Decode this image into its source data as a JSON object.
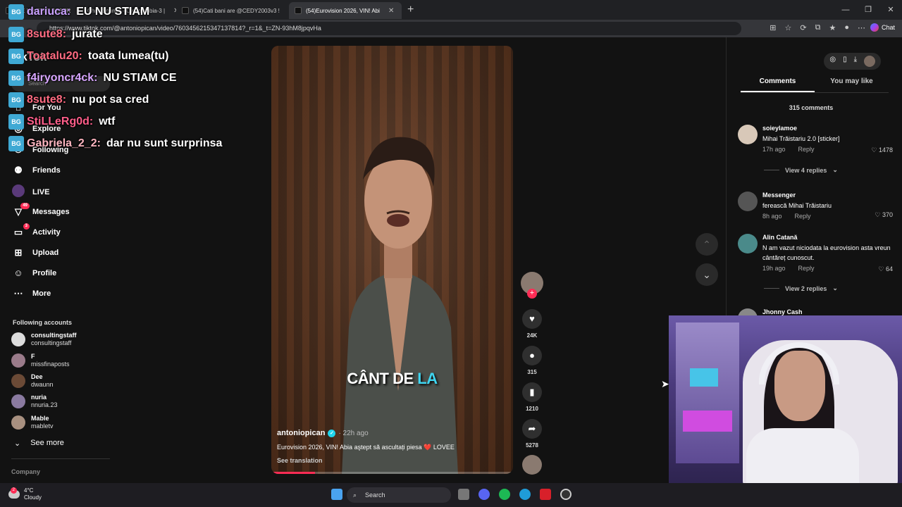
{
  "browser": {
    "tabs": [
      {
        "label": "CE NU STITI DESPRE BISOI - YouT",
        "active": false
      },
      {
        "label": "Chris Sounds - Oleaor fobia-3 |",
        "active": false
      },
      {
        "label": "(54)Cati bani are @CEDY2003v3 !",
        "active": false
      },
      {
        "label": "(54)Eurovision 2026, VIN! Abi",
        "active": true
      }
    ],
    "url": "https://www.tiktok.com/@antoniopican/video/7603456215347137814?_r=1&_t=ZN-93hM8jpqvHa",
    "chat_label": "Chat"
  },
  "sidebar": {
    "logo": "TikTok",
    "search_placeholder": "Search",
    "nav": [
      {
        "label": "For You",
        "icon": "home-icon"
      },
      {
        "label": "Explore",
        "icon": "compass-icon"
      },
      {
        "label": "Following",
        "icon": "following-icon"
      },
      {
        "label": "Friends",
        "icon": "friends-icon"
      },
      {
        "label": "LIVE",
        "icon": "live-icon"
      },
      {
        "label": "Messages",
        "icon": "messages-icon",
        "badge": "49"
      },
      {
        "label": "Activity",
        "icon": "activity-icon",
        "badge": "3"
      },
      {
        "label": "Upload",
        "icon": "upload-icon"
      },
      {
        "label": "Profile",
        "icon": "profile-icon"
      },
      {
        "label": "More",
        "icon": "more-icon"
      }
    ],
    "following_header": "Following accounts",
    "accounts": [
      {
        "name": "consultingstaff",
        "handle": "consultingstaff"
      },
      {
        "name": "F",
        "handle": "missfinaposts"
      },
      {
        "name": "Dee",
        "handle": "dwaunn"
      },
      {
        "name": "nuria",
        "handle": "nnuria.23"
      },
      {
        "name": "Mable",
        "handle": "mabletv"
      }
    ],
    "see_more": "See more",
    "company": "Company"
  },
  "chat_overlay": [
    {
      "user": "dariuca:",
      "msg": "EU NU STIAM",
      "color": "#c9a0ff"
    },
    {
      "user": "8sute8:",
      "msg": "jurate",
      "color": "#ff6b81"
    },
    {
      "user": "Toatalu20:",
      "msg": "toata lumea(tu)",
      "color": "#ff6b81"
    },
    {
      "user": "f4iryoncr4ck:",
      "msg": "NU STIAM CE",
      "color": "#d8a6ff"
    },
    {
      "user": "8sute8:",
      "msg": "nu pot sa cred",
      "color": "#ff6b81"
    },
    {
      "user": "StiLLeRg0d:",
      "msg": "wtf",
      "color": "#ff5e8a"
    },
    {
      "user": "Gabriela_2_2:",
      "msg": "dar nu sunt surprinsa",
      "color": "#ffb6c1"
    }
  ],
  "video": {
    "caption_white": "CÂNT DE",
    "caption_hl": "LA",
    "username": "antoniopican",
    "time": "· 22h ago",
    "description": "Eurovision 2026, VIN! Abia aştept să ascultați piesa ❤️ LOVEE",
    "see_translation": "See translation",
    "progress": 0.18
  },
  "actions": {
    "likes": "24K",
    "comments": "315",
    "saves": "1210",
    "shares": "5278"
  },
  "comments_panel": {
    "tab_comments": "Comments",
    "tab_youmaylike": "You may like",
    "count": "315 comments",
    "items": [
      {
        "name": "soieylamoe",
        "text": "Mihai Trăistariu 2.0 [sticker]",
        "time": "17h ago",
        "reply": "Reply",
        "likes": "1478",
        "view_replies": "View 4 replies"
      },
      {
        "name": "Messenger",
        "text": "ferească Mihai Trăistariu",
        "time": "8h ago",
        "reply": "Reply",
        "likes": "370",
        "view_replies": ""
      },
      {
        "name": "Alin Catană",
        "text": "N am vazut niciodata la eurovision asta vreun cântăreț cunoscut.",
        "time": "19h ago",
        "reply": "Reply",
        "likes": "64",
        "view_replies": "View 2 replies"
      },
      {
        "name": "Jhonny Cash",
        "text": "",
        "time": "",
        "reply": "",
        "likes": "",
        "view_replies": ""
      }
    ]
  },
  "taskbar": {
    "temp": "4°C",
    "weather": "Cloudy",
    "search": "Search",
    "weather_badge": "2"
  }
}
